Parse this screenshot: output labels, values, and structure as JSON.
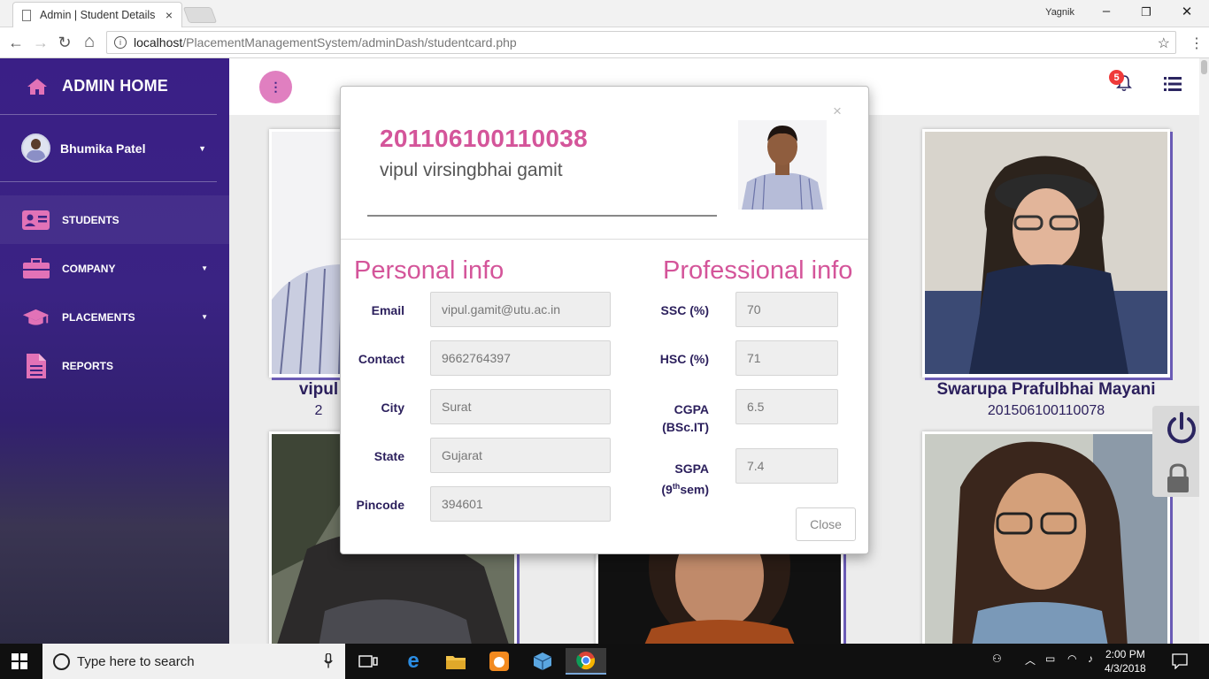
{
  "browser": {
    "tab_title": "Admin | Student Details",
    "tab_close": "×",
    "profile_name": "Yagnik",
    "url_host": "localhost",
    "url_path": "/PlacementManagementSystem/adminDash/studentcard.php",
    "min": "–",
    "max": "❐",
    "close": "✕",
    "back": "←",
    "forward": "→",
    "reload": "↻",
    "home": "⌂",
    "star": "☆",
    "menu": "⋮"
  },
  "sidebar": {
    "title": "ADMIN HOME",
    "user_name": "Bhumika Patel",
    "items": [
      {
        "label": "STUDENTS",
        "icon": "id-card-icon"
      },
      {
        "label": "COMPANY",
        "icon": "briefcase-icon",
        "has_arrow": true
      },
      {
        "label": "PLACEMENTS",
        "icon": "graduation-cap-icon",
        "has_arrow": true
      },
      {
        "label": "REPORTS",
        "icon": "file-icon"
      }
    ],
    "accent": "#e272b7"
  },
  "header": {
    "fab_label": "⋮",
    "notification_count": "5"
  },
  "cards": [
    {
      "name": "vipul",
      "id": "2"
    },
    {
      "name": "Swarupa Prafulbhai Mayani",
      "id": "201506100110078"
    }
  ],
  "modal": {
    "close_x": "×",
    "student_id": "201106100110038",
    "student_name": "vipul virsingbhai gamit",
    "personal_title": "Personal info",
    "professional_title": "Professional info",
    "personal": [
      {
        "label": "Email",
        "value": "vipul.gamit@utu.ac.in"
      },
      {
        "label": "Contact",
        "value": "9662764397"
      },
      {
        "label": "City",
        "value": "Surat"
      },
      {
        "label": "State",
        "value": "Gujarat"
      },
      {
        "label": "Pincode",
        "value": "394601"
      }
    ],
    "professional": [
      {
        "label": "SSC (%)",
        "value": "70"
      },
      {
        "label": "HSC (%)",
        "value": "71"
      },
      {
        "label_line1": "CGPA",
        "label_line2": "(BSc.IT)",
        "value": "6.5"
      },
      {
        "label_pre": "SGPA",
        "label_open": "(9",
        "label_sup": "th",
        "label_post": "sem)",
        "value": "7.4"
      }
    ],
    "close_button": "Close",
    "accent": "#d4559a"
  },
  "taskbar": {
    "search_placeholder": "Type here to search",
    "time": "2:00 PM",
    "date": "4/3/2018"
  }
}
